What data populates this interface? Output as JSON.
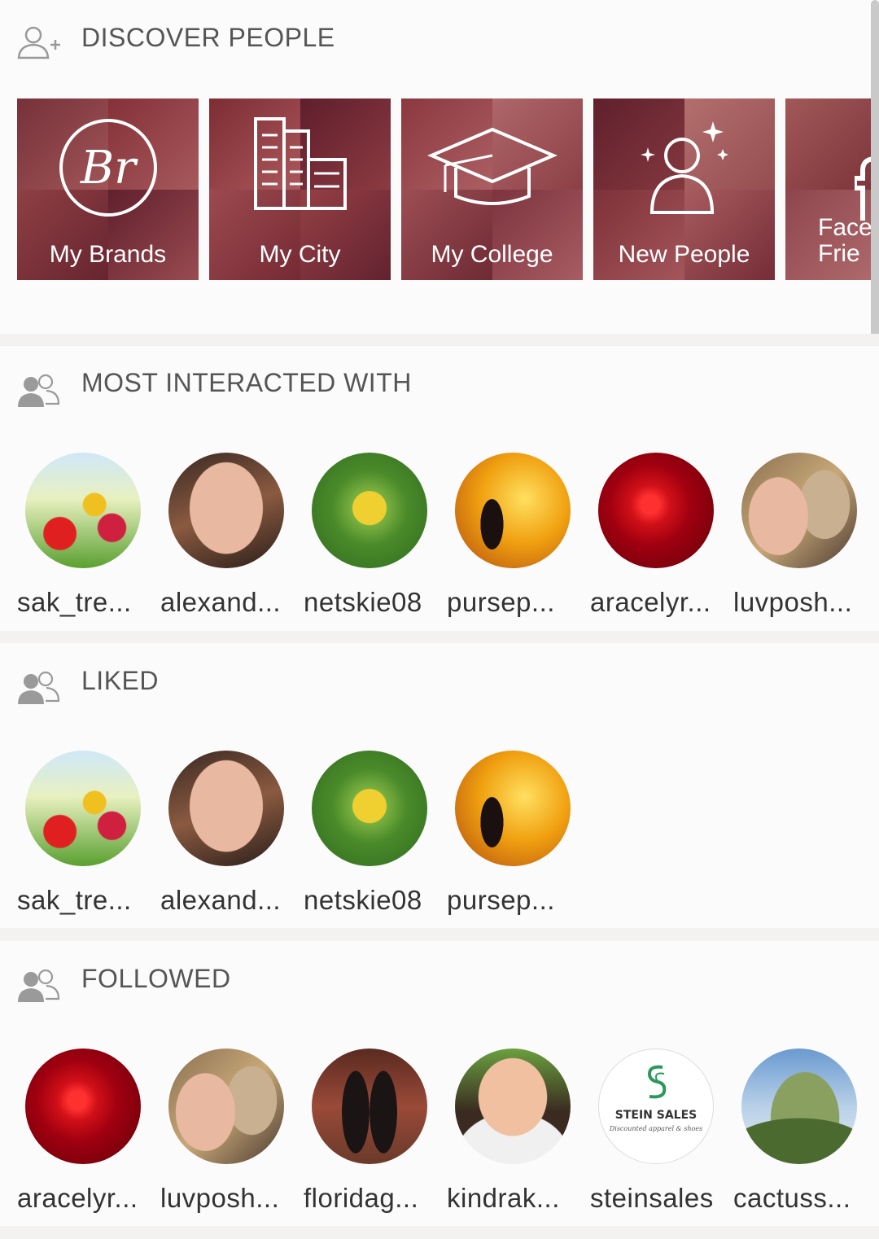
{
  "discover": {
    "title": "DISCOVER PEOPLE",
    "tiles": [
      {
        "label": "My Brands",
        "icon": "brand-logo-icon"
      },
      {
        "label": "My City",
        "icon": "city-icon"
      },
      {
        "label": "My College",
        "icon": "graduation-cap-icon"
      },
      {
        "label": "New People",
        "icon": "new-person-icon"
      },
      {
        "label": "Face\nFrie",
        "icon": "facebook-icon"
      }
    ]
  },
  "most_interacted": {
    "title": "MOST INTERACTED WITH",
    "people": [
      "sak_tre...",
      "alexand...",
      "netskie08",
      "pursep...",
      "aracelyr...",
      "luvposh..."
    ]
  },
  "liked": {
    "title": "LIKED",
    "people": [
      "sak_tre...",
      "alexand...",
      "netskie08",
      "pursep..."
    ]
  },
  "followed": {
    "title": "FOLLOWED",
    "people": [
      "aracelyr...",
      "luvposh...",
      "floridag...",
      "kindrak...",
      "steinsales",
      "cactuss..."
    ],
    "stein_logo": {
      "name": "STEIN SALES",
      "tagline": "Discounted apparel & shoes"
    }
  },
  "colors": {
    "tile_overlay": "#801e37",
    "header_text": "#555555",
    "name_text": "#333333"
  }
}
